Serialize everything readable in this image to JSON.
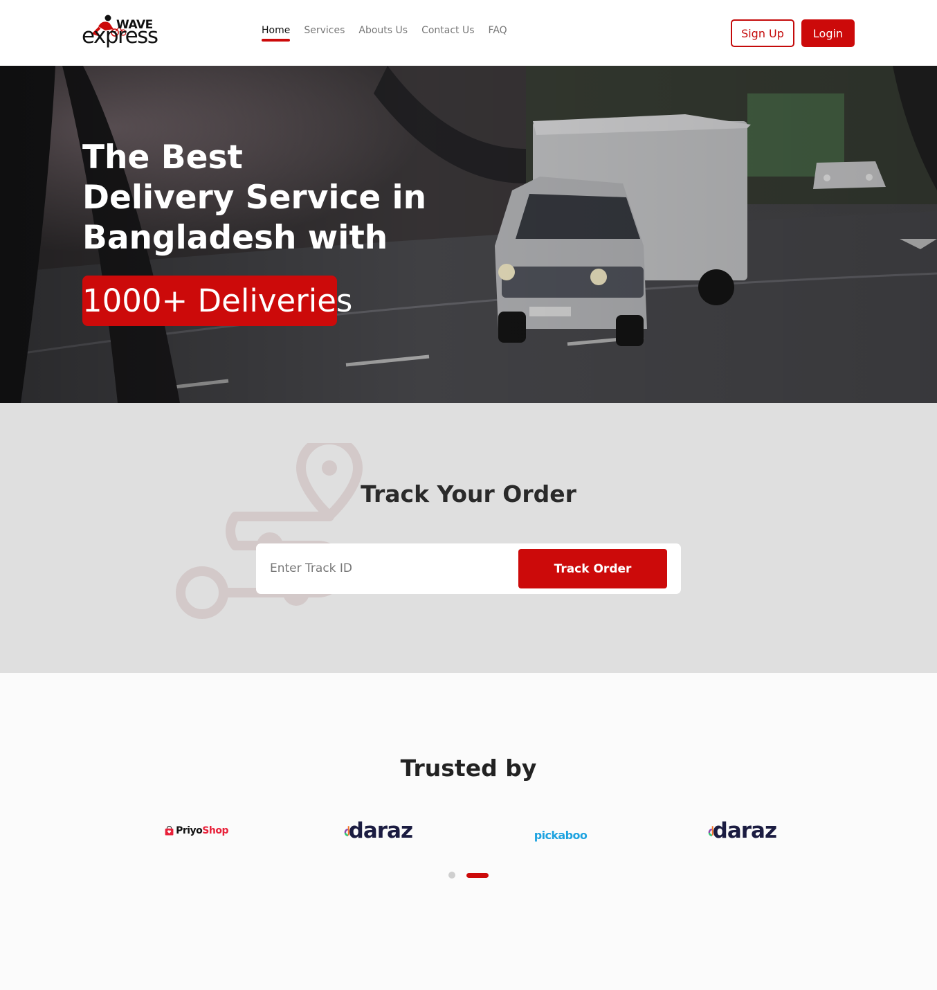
{
  "brand": {
    "logo_top": "WAVE",
    "logo_bottom": "express",
    "accent_color": "#cc0a0a"
  },
  "nav": {
    "links": [
      {
        "label": "Home",
        "active": true
      },
      {
        "label": "Services",
        "active": false
      },
      {
        "label": "Abouts Us",
        "active": false
      },
      {
        "label": "Contact Us",
        "active": false
      },
      {
        "label": "FAQ",
        "active": false
      }
    ],
    "signup_label": "Sign Up",
    "login_label": "Login"
  },
  "hero": {
    "title_lines": [
      "The Best",
      "Delivery Service in",
      "Bangladesh with"
    ],
    "badge": "1000+ Deliveries"
  },
  "track": {
    "title": "Track Your Order",
    "placeholder": "Enter Track ID",
    "value": "",
    "button_label": "Track Order",
    "icon": "route-pin-icon"
  },
  "trusted": {
    "title": "Trusted by",
    "partners": [
      {
        "name": "PriyoShop",
        "part1": "Priyo",
        "part2": "Shop",
        "icon": "shopping-bag-icon"
      },
      {
        "name": "daraz",
        "text": "daraz"
      },
      {
        "name": "pickaboo",
        "text": "pickaboo"
      },
      {
        "name": "daraz",
        "text": "daraz"
      }
    ],
    "carousel": {
      "pages": 2,
      "active_page": 2
    }
  }
}
